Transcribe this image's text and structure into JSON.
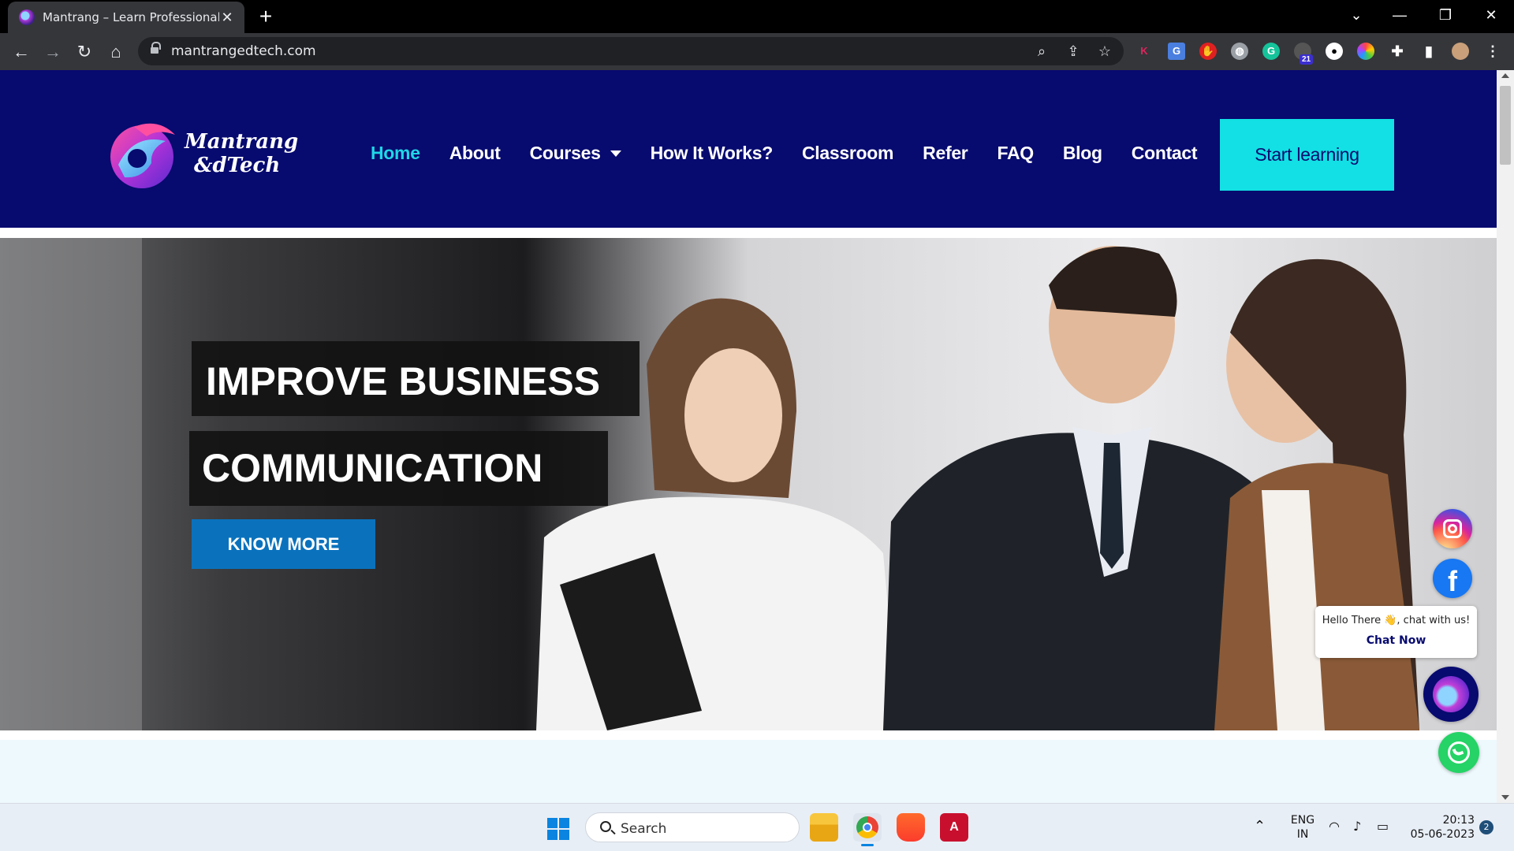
{
  "browser": {
    "tab_title": "Mantrang – Learn Professional En",
    "url": "mantrangedtech.com",
    "extension_badge": "21"
  },
  "site": {
    "logo_line1": "Mantrang",
    "logo_line2": "&dTech",
    "nav": [
      {
        "label": "Home",
        "active": true
      },
      {
        "label": "About"
      },
      {
        "label": "Courses",
        "dropdown": true
      },
      {
        "label": "How It Works?"
      },
      {
        "label": "Classroom"
      },
      {
        "label": "Refer"
      },
      {
        "label": "FAQ"
      },
      {
        "label": "Blog"
      },
      {
        "label": "Contact"
      }
    ],
    "cta_label": "Start learning",
    "colors": {
      "header_bg": "#070a6f",
      "accent": "#12e0e4",
      "active_link": "#1fd6e6",
      "button_blue": "#0a72bd"
    }
  },
  "hero": {
    "line1": "IMPROVE BUSINESS",
    "line2": "COMMUNICATION",
    "button": "KNOW MORE"
  },
  "chat_widget": {
    "greeting": "Hello There 👋, chat with us!",
    "action": "Chat Now"
  },
  "taskbar": {
    "search_placeholder": "Search",
    "lang_line1": "ENG",
    "lang_line2": "IN",
    "time": "20:13",
    "date": "05-06-2023",
    "notification_count": "2"
  }
}
